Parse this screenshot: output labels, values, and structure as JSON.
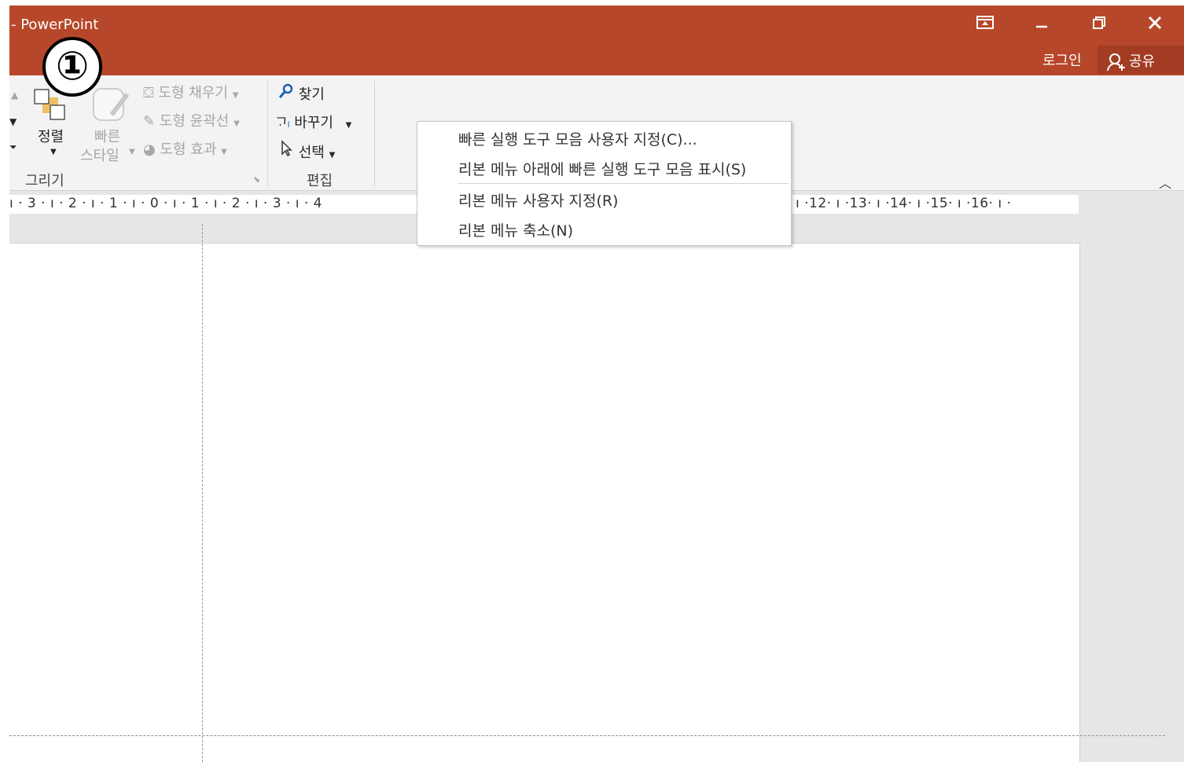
{
  "window": {
    "title": "- PowerPoint",
    "controls": {
      "ribbon_display": "⊡",
      "minimize": "–",
      "restore": "🗗",
      "close": "✕"
    },
    "login": "로그인",
    "share": "공유"
  },
  "annotation": {
    "number": "①"
  },
  "ribbon": {
    "arrange": {
      "label": "정렬"
    },
    "quick_styles": {
      "line1": "빠른",
      "line2": "스타일"
    },
    "shape_fill": "도형 채우기",
    "shape_outline": "도형 윤곽선",
    "shape_effects": "도형 효과",
    "drawing_group": "그리기",
    "find": "찾기",
    "replace": "바꾸기",
    "select": "선택",
    "editing_group": "편집"
  },
  "ruler": {
    "text": "ı · 3 · ı · 2 · ı · 1 · ı · 0 · ı · 1 · ı · 2 · ı · 3 · ı · 4",
    "text_right": "ı ·12· ı ·13· ı ·14· ı ·15· ı ·16· ı ·"
  },
  "context_menu": {
    "items": [
      "빠른 실행 도구 모음 사용자 지정(C)...",
      "리본 메뉴 아래에 빠른 실행 도구 모음 표시(S)",
      "리본 메뉴 사용자 지정(R)",
      "리본 메뉴 축소(N)"
    ]
  },
  "colors": {
    "titlebar": "#b7472a",
    "ribbon": "#f3f3f3",
    "canvas": "#e6e6e6"
  }
}
